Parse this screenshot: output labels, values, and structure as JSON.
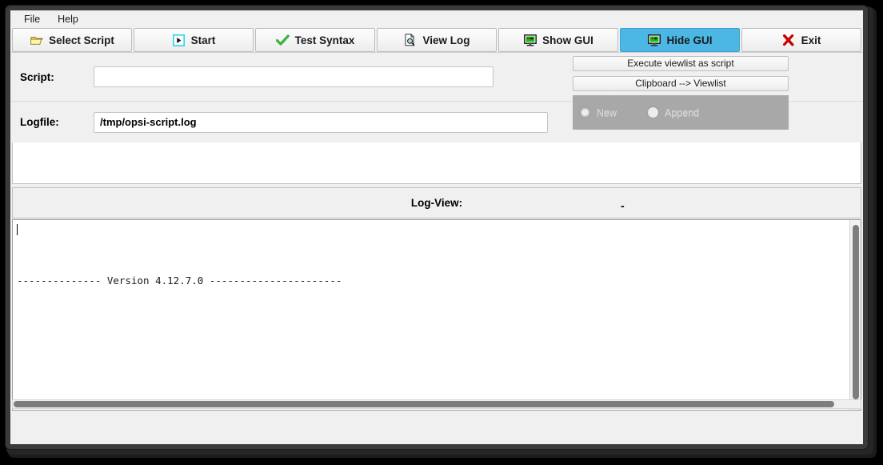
{
  "window": {
    "frame_color": "#3a3a3a",
    "client_bg": "#f0f0f0"
  },
  "menubar": {
    "items": [
      {
        "label": "File",
        "name": "menu-file"
      },
      {
        "label": "Help",
        "name": "menu-help"
      }
    ]
  },
  "toolbar": {
    "active_color": "#4cb6e5",
    "buttons": [
      {
        "label": "Select Script",
        "icon": "open-folder-icon",
        "active": false
      },
      {
        "label": "Start",
        "icon": "play-icon",
        "active": false
      },
      {
        "label": "Test Syntax",
        "icon": "check-mark-icon",
        "active": false
      },
      {
        "label": "View Log",
        "icon": "document-search-icon",
        "active": false
      },
      {
        "label": "Show GUI",
        "icon": "monitor-icon",
        "active": false
      },
      {
        "label": "Hide GUI",
        "icon": "monitor-icon",
        "active": true
      },
      {
        "label": "Exit",
        "icon": "red-x-icon",
        "active": false
      }
    ]
  },
  "form": {
    "script": {
      "label": "Script:",
      "value": "",
      "placeholder": ""
    },
    "logfile": {
      "label": "Logfile:",
      "value": "/tmp/opsi-script.log",
      "placeholder": ""
    }
  },
  "side_panel": {
    "buttons": [
      {
        "label": "Execute viewlist as script"
      },
      {
        "label": "Clipboard --> Viewlist"
      }
    ],
    "log_mode": {
      "enabled": false,
      "options": [
        {
          "label": "New",
          "selected": true
        },
        {
          "label": "Append",
          "selected": false
        }
      ]
    }
  },
  "logview": {
    "title": "Log-View:",
    "marker": "-",
    "content": "-------------- Version 4.12.7.0 ----------------------"
  }
}
